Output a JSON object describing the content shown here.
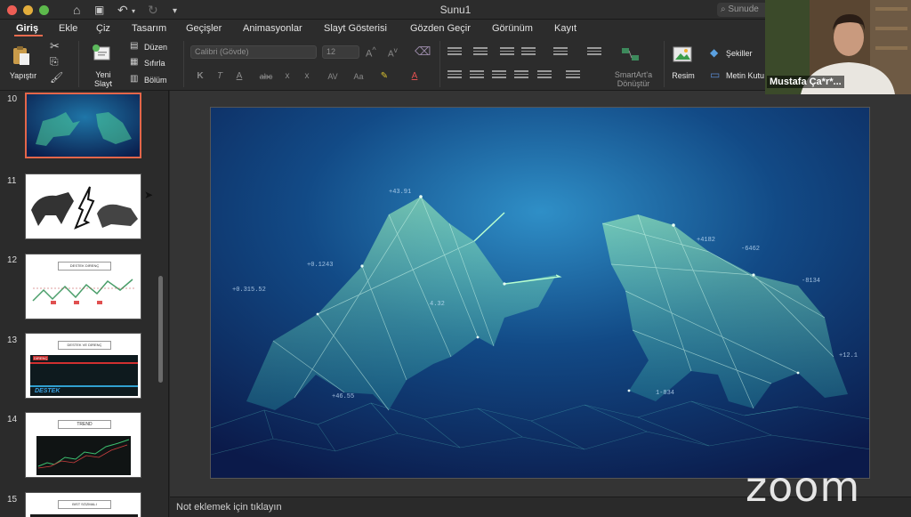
{
  "window": {
    "title": "Sunu1",
    "search_placeholder": "Sunude"
  },
  "tabs": [
    "Giriş",
    "Ekle",
    "Çiz",
    "Tasarım",
    "Geçişler",
    "Animasyonlar",
    "Slayt Gösterisi",
    "Gözden Geçir",
    "Görünüm",
    "Kayıt"
  ],
  "ribbon": {
    "paste": "Yapıştır",
    "new_slide_1": "Yeni",
    "new_slide_2": "Slayt",
    "layout": "Düzen",
    "reset": "Sıfırla",
    "section": "Bölüm",
    "font": "Calibri (Gövde)",
    "font_size": "12",
    "smartart_1": "SmartArt'a",
    "smartart_2": "Dönüştür",
    "picture": "Resim",
    "shapes": "Şekiller",
    "textbox": "Metin Kutu"
  },
  "thumbnails": [
    {
      "num": "10",
      "title": ""
    },
    {
      "num": "11",
      "title": ""
    },
    {
      "num": "12",
      "title": "DESTEK DİRENÇ"
    },
    {
      "num": "13",
      "title": "DESTEK VE DİRENÇ",
      "label": "DESTEK",
      "label2": "DİRENÇ"
    },
    {
      "num": "14",
      "title": "TREND"
    },
    {
      "num": "15",
      "title": "BIST SÖZMALI"
    }
  ],
  "notes_placeholder": "Not eklemek için tıklayın",
  "webcam": {
    "name": "Mustafa Ça*r*..."
  },
  "zoom_watermark": "zoom",
  "slide_numbers": [
    "+43.91",
    "+0.1243",
    "4.32",
    "+0.315.52",
    "+4182",
    "-6462",
    "+46.55",
    "-8134",
    "+12.1",
    "1-834"
  ],
  "colors": {
    "accent": "#e4664a",
    "ribbon_bg": "#2c2c2c",
    "slide_bg": "#0b3d6b",
    "polygon": "#7ee8a8"
  }
}
